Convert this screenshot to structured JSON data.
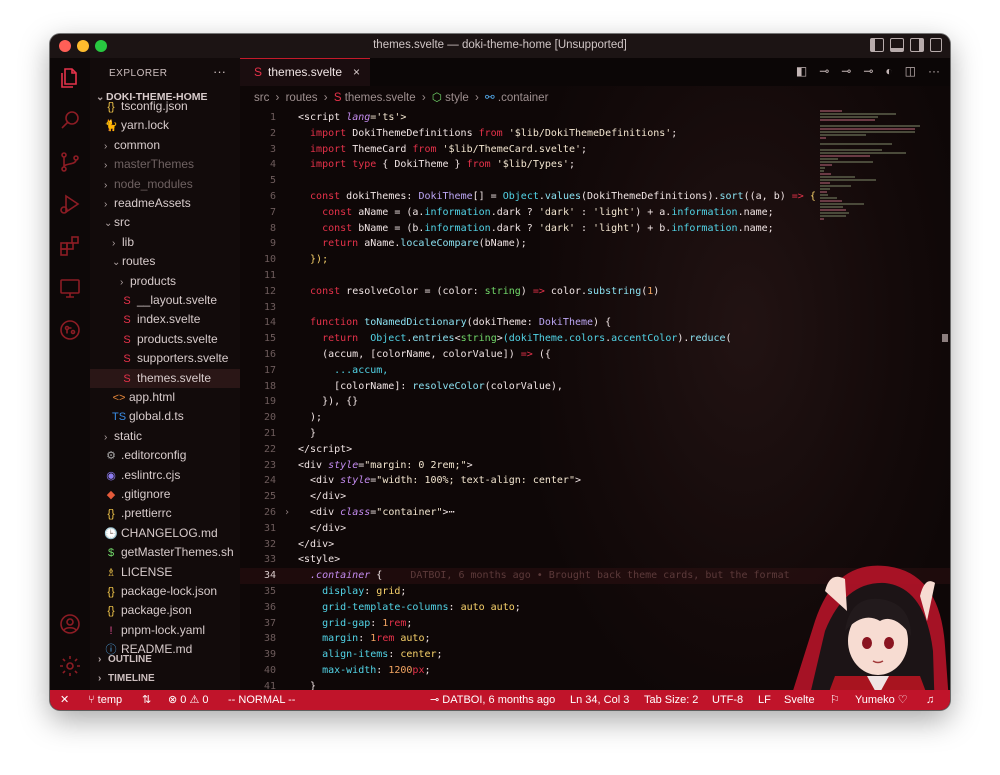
{
  "window": {
    "title": "themes.svelte — doki-theme-home [Unsupported]"
  },
  "colors": {
    "accent": "#c0142a",
    "keyword": "#e5324a",
    "variable": "#52d4e7",
    "string": "#f3e6d0"
  },
  "activity_bar": [
    {
      "icon": "files-icon"
    },
    {
      "icon": "search-icon"
    },
    {
      "icon": "source-control-icon"
    },
    {
      "icon": "run-debug-icon"
    },
    {
      "icon": "extensions-icon"
    },
    {
      "icon": "remote-explorer-icon"
    },
    {
      "icon": "github-icon"
    },
    {
      "icon": "account-icon"
    },
    {
      "icon": "settings-gear-icon"
    }
  ],
  "sidebar": {
    "header": "EXPLORER",
    "more": "···",
    "root": "DOKI-THEME-HOME",
    "items": [
      {
        "label": "tsconfig.json",
        "icon": "{}",
        "color": "#f3c74a",
        "indent": 1,
        "kind": "file"
      },
      {
        "label": "yarn.lock",
        "icon": "🐈",
        "color": "#58a8e8",
        "indent": 1,
        "kind": "file"
      },
      {
        "label": "common",
        "indent": 1,
        "kind": "folder"
      },
      {
        "label": "masterThemes",
        "indent": 1,
        "kind": "folder",
        "dim": true
      },
      {
        "label": "node_modules",
        "indent": 1,
        "kind": "folder",
        "dim": true
      },
      {
        "label": "readmeAssets",
        "indent": 1,
        "kind": "folder"
      },
      {
        "label": "src",
        "indent": 1,
        "kind": "folder-open"
      },
      {
        "label": "lib",
        "indent": 2,
        "kind": "folder"
      },
      {
        "label": "routes",
        "indent": 2,
        "kind": "folder-open"
      },
      {
        "label": "products",
        "indent": 3,
        "kind": "folder"
      },
      {
        "label": "__layout.svelte",
        "icon": "S",
        "color": "#e5324a",
        "indent": 3,
        "kind": "file"
      },
      {
        "label": "index.svelte",
        "icon": "S",
        "color": "#e5324a",
        "indent": 3,
        "kind": "file"
      },
      {
        "label": "products.svelte",
        "icon": "S",
        "color": "#e5324a",
        "indent": 3,
        "kind": "file"
      },
      {
        "label": "supporters.svelte",
        "icon": "S",
        "color": "#e5324a",
        "indent": 3,
        "kind": "file"
      },
      {
        "label": "themes.svelte",
        "icon": "S",
        "color": "#e5324a",
        "indent": 3,
        "kind": "file",
        "selected": true
      },
      {
        "label": "app.html",
        "icon": "<>",
        "color": "#e8883a",
        "indent": 2,
        "kind": "file"
      },
      {
        "label": "global.d.ts",
        "icon": "TS",
        "color": "#3a8ee8",
        "indent": 2,
        "kind": "file"
      },
      {
        "label": "static",
        "indent": 1,
        "kind": "folder"
      },
      {
        "label": ".editorconfig",
        "icon": "⚙",
        "color": "#a9a9a9",
        "indent": 1,
        "kind": "file"
      },
      {
        "label": ".eslintrc.cjs",
        "icon": "◉",
        "color": "#8d7cf0",
        "indent": 1,
        "kind": "file"
      },
      {
        "label": ".gitignore",
        "icon": "◆",
        "color": "#e55a3a",
        "indent": 1,
        "kind": "file"
      },
      {
        "label": ".prettierrc",
        "icon": "{}",
        "color": "#f3c74a",
        "indent": 1,
        "kind": "file"
      },
      {
        "label": "CHANGELOG.md",
        "icon": "🕒",
        "color": "#52a8e8",
        "indent": 1,
        "kind": "file"
      },
      {
        "label": "getMasterThemes.sh",
        "icon": "$",
        "color": "#72d86a",
        "indent": 1,
        "kind": "file"
      },
      {
        "label": "LICENSE",
        "icon": "♗",
        "color": "#f3c74a",
        "indent": 1,
        "kind": "file"
      },
      {
        "label": "package-lock.json",
        "icon": "{}",
        "color": "#f3c74a",
        "indent": 1,
        "kind": "file"
      },
      {
        "label": "package.json",
        "icon": "{}",
        "color": "#f3c74a",
        "indent": 1,
        "kind": "file"
      },
      {
        "label": "pnpm-lock.yaml",
        "icon": "!",
        "color": "#d84a8a",
        "indent": 1,
        "kind": "file"
      },
      {
        "label": "README.md",
        "icon": "ⓘ",
        "color": "#52a8e8",
        "indent": 1,
        "kind": "file"
      }
    ],
    "sections": [
      "OUTLINE",
      "TIMELINE"
    ]
  },
  "editor": {
    "tab_label": "themes.svelte",
    "tab_close": "×",
    "breadcrumb": [
      "src",
      "routes",
      "themes.svelte",
      "style",
      ".container"
    ],
    "blame": "DATBOI, 6 months ago • Brought back theme cards, but the format",
    "lines": [
      {
        "n": "1",
        "h": [
          [
            "<",
            "tag"
          ],
          [
            "script ",
            "tag"
          ],
          [
            "lang",
            "attr"
          ],
          [
            "='ts'>",
            "s"
          ]
        ]
      },
      {
        "n": "2",
        "h": [
          [
            "  import ",
            "k"
          ],
          [
            "DokiThemeDefinitions ",
            "t"
          ],
          [
            "from ",
            "k"
          ],
          [
            "'$lib/DokiThemeDefinitions'",
            "s"
          ],
          [
            ";",
            "t"
          ]
        ]
      },
      {
        "n": "3",
        "h": [
          [
            "  import ",
            "k"
          ],
          [
            "ThemeCard ",
            "t"
          ],
          [
            "from ",
            "k"
          ],
          [
            "'$lib/ThemeCard.svelte'",
            "s"
          ],
          [
            ";",
            "t"
          ]
        ]
      },
      {
        "n": "4",
        "h": [
          [
            "  import ",
            "k"
          ],
          [
            "type ",
            "k"
          ],
          [
            "{ DokiTheme } ",
            "t"
          ],
          [
            "from ",
            "k"
          ],
          [
            "'$lib/Types'",
            "s"
          ],
          [
            ";",
            "t"
          ]
        ]
      },
      {
        "n": "5",
        "h": []
      },
      {
        "n": "6",
        "h": [
          [
            "  const ",
            "k"
          ],
          [
            "dokiThemes",
            "t"
          ],
          [
            ": ",
            "t"
          ],
          [
            "DokiTheme",
            "ty"
          ],
          [
            "[] = ",
            "t"
          ],
          [
            "Object",
            "v"
          ],
          [
            ".",
            "t"
          ],
          [
            "values",
            "f"
          ],
          [
            "(DokiThemeDefinitions).",
            "t"
          ],
          [
            "sort",
            "f"
          ],
          [
            "((a, b) ",
            "t"
          ],
          [
            "=> ",
            "o"
          ],
          [
            "{",
            "y"
          ]
        ]
      },
      {
        "n": "7",
        "h": [
          [
            "    const ",
            "k"
          ],
          [
            "aName ",
            "t"
          ],
          [
            "= (a.",
            "t"
          ],
          [
            "information",
            "v"
          ],
          [
            ".dark ? ",
            "t"
          ],
          [
            "'dark'",
            "s"
          ],
          [
            " : ",
            "t"
          ],
          [
            "'light'",
            "s"
          ],
          [
            ") + a.",
            "t"
          ],
          [
            "information",
            "v"
          ],
          [
            ".name;",
            "t"
          ]
        ]
      },
      {
        "n": "8",
        "h": [
          [
            "    const ",
            "k"
          ],
          [
            "bName ",
            "t"
          ],
          [
            "= (b.",
            "t"
          ],
          [
            "information",
            "v"
          ],
          [
            ".dark ? ",
            "t"
          ],
          [
            "'dark'",
            "s"
          ],
          [
            " : ",
            "t"
          ],
          [
            "'light'",
            "s"
          ],
          [
            ") + b.",
            "t"
          ],
          [
            "information",
            "v"
          ],
          [
            ".name;",
            "t"
          ]
        ]
      },
      {
        "n": "9",
        "h": [
          [
            "    return ",
            "k"
          ],
          [
            "aName.",
            "t"
          ],
          [
            "localeCompare",
            "f"
          ],
          [
            "(bName);",
            "t"
          ]
        ]
      },
      {
        "n": "10",
        "h": [
          [
            "  });",
            "y"
          ]
        ]
      },
      {
        "n": "11",
        "h": []
      },
      {
        "n": "12",
        "h": [
          [
            "  const ",
            "k"
          ],
          [
            "resolveColor ",
            "t"
          ],
          [
            "= (color: ",
            "t"
          ],
          [
            "string",
            "g"
          ],
          [
            ") ",
            "t"
          ],
          [
            "=> ",
            "o"
          ],
          [
            "color.",
            "t"
          ],
          [
            "substring",
            "f"
          ],
          [
            "(",
            "t"
          ],
          [
            "1",
            "num"
          ],
          [
            ")",
            "t"
          ]
        ]
      },
      {
        "n": "13",
        "h": []
      },
      {
        "n": "14",
        "h": [
          [
            "  function ",
            "k"
          ],
          [
            "toNamedDictionary",
            "f"
          ],
          [
            "(dokiTheme: ",
            "t"
          ],
          [
            "DokiTheme",
            "ty"
          ],
          [
            ") {",
            "t"
          ]
        ]
      },
      {
        "n": "15",
        "h": [
          [
            "    return  ",
            "k"
          ],
          [
            "Object",
            "v"
          ],
          [
            ".",
            "t"
          ],
          [
            "entries",
            "f"
          ],
          [
            "<",
            "t"
          ],
          [
            "string",
            "g"
          ],
          [
            ">",
            "t"
          ],
          [
            "(dokiTheme.",
            "v"
          ],
          [
            "colors",
            "v"
          ],
          [
            ".",
            "t"
          ],
          [
            "accentColor",
            "v"
          ],
          [
            ").",
            "t"
          ],
          [
            "reduce",
            "f"
          ],
          [
            "(",
            "t"
          ]
        ]
      },
      {
        "n": "16",
        "h": [
          [
            "    (accum, [colorName, colorValue]) ",
            "t"
          ],
          [
            "=> ",
            "o"
          ],
          [
            "({",
            "t"
          ]
        ]
      },
      {
        "n": "17",
        "h": [
          [
            "      ...accum,",
            "v"
          ]
        ]
      },
      {
        "n": "18",
        "h": [
          [
            "      [colorName]",
            "t"
          ],
          [
            ": ",
            "t"
          ],
          [
            "resolveColor",
            "f"
          ],
          [
            "(colorValue),",
            "t"
          ]
        ]
      },
      {
        "n": "19",
        "h": [
          [
            "    }), {}",
            "t"
          ]
        ]
      },
      {
        "n": "20",
        "h": [
          [
            "  );",
            "t"
          ]
        ]
      },
      {
        "n": "21",
        "h": [
          [
            "  }",
            "t"
          ]
        ]
      },
      {
        "n": "22",
        "h": [
          [
            "</",
            "tag"
          ],
          [
            "script",
            "tag"
          ],
          [
            ">",
            "tag"
          ]
        ]
      },
      {
        "n": "23",
        "h": [
          [
            "<div ",
            "tag"
          ],
          [
            "style",
            "attr"
          ],
          [
            "=",
            "t"
          ],
          [
            "\"margin: 0 2rem;\"",
            "s"
          ],
          [
            ">",
            "tag"
          ]
        ]
      },
      {
        "n": "24",
        "h": [
          [
            "  <div ",
            "tag"
          ],
          [
            "style",
            "attr"
          ],
          [
            "=",
            "t"
          ],
          [
            "\"width: 100%; text-align: center\"",
            "s"
          ],
          [
            ">",
            "tag"
          ]
        ]
      },
      {
        "n": "25",
        "h": [
          [
            "  </div>",
            "tag"
          ]
        ]
      },
      {
        "n": "26",
        "h": [
          [
            "  <div ",
            "tag"
          ],
          [
            "class",
            "attr"
          ],
          [
            "=",
            "t"
          ],
          [
            "\"container\"",
            "s"
          ],
          [
            ">",
            "tag"
          ],
          [
            "⋯",
            "t"
          ]
        ],
        "fold": "›"
      },
      {
        "n": "31",
        "h": [
          [
            "  </div>",
            "tag"
          ]
        ]
      },
      {
        "n": "32",
        "h": [
          [
            "</div>",
            "tag"
          ]
        ]
      },
      {
        "n": "33",
        "h": [
          [
            "<style>",
            "tag"
          ]
        ]
      },
      {
        "n": "34",
        "h": [
          [
            "  .container ",
            "attr"
          ],
          [
            "{",
            "t"
          ]
        ],
        "current": true
      },
      {
        "n": "35",
        "h": [
          [
            "    display",
            "v"
          ],
          [
            ": ",
            "t"
          ],
          [
            "grid",
            "y"
          ],
          [
            ";",
            "t"
          ]
        ]
      },
      {
        "n": "36",
        "h": [
          [
            "    grid-template-columns",
            "v"
          ],
          [
            ": ",
            "t"
          ],
          [
            "auto auto",
            "y"
          ],
          [
            ";",
            "t"
          ]
        ]
      },
      {
        "n": "37",
        "h": [
          [
            "    grid-gap",
            "v"
          ],
          [
            ": ",
            "t"
          ],
          [
            "1",
            "num"
          ],
          [
            "rem",
            "k"
          ],
          [
            ";",
            "t"
          ]
        ]
      },
      {
        "n": "38",
        "h": [
          [
            "    margin",
            "v"
          ],
          [
            ": ",
            "t"
          ],
          [
            "1",
            "num"
          ],
          [
            "rem ",
            "k"
          ],
          [
            "auto",
            "y"
          ],
          [
            ";",
            "t"
          ]
        ]
      },
      {
        "n": "39",
        "h": [
          [
            "    align-items",
            "v"
          ],
          [
            ": ",
            "t"
          ],
          [
            "center",
            "y"
          ],
          [
            ";",
            "t"
          ]
        ]
      },
      {
        "n": "40",
        "h": [
          [
            "    max-width",
            "v"
          ],
          [
            ": ",
            "t"
          ],
          [
            "1200",
            "num"
          ],
          [
            "px",
            "k"
          ],
          [
            ";",
            "t"
          ]
        ]
      },
      {
        "n": "41",
        "h": [
          [
            "  }",
            "t"
          ]
        ]
      }
    ]
  },
  "statusbar": {
    "close": "✕",
    "branch": "temp",
    "sync": "⇅",
    "problems": "⊗ 0 ⚠ 0",
    "mode": "-- NORMAL --",
    "blame": "DATBOI, 6 months ago",
    "position": "Ln 34, Col 3",
    "tab_size": "Tab Size: 2",
    "encoding": "UTF-8",
    "eol": "LF",
    "language": "Svelte",
    "theme": "Yumeko ♡",
    "bell": "🔔"
  }
}
